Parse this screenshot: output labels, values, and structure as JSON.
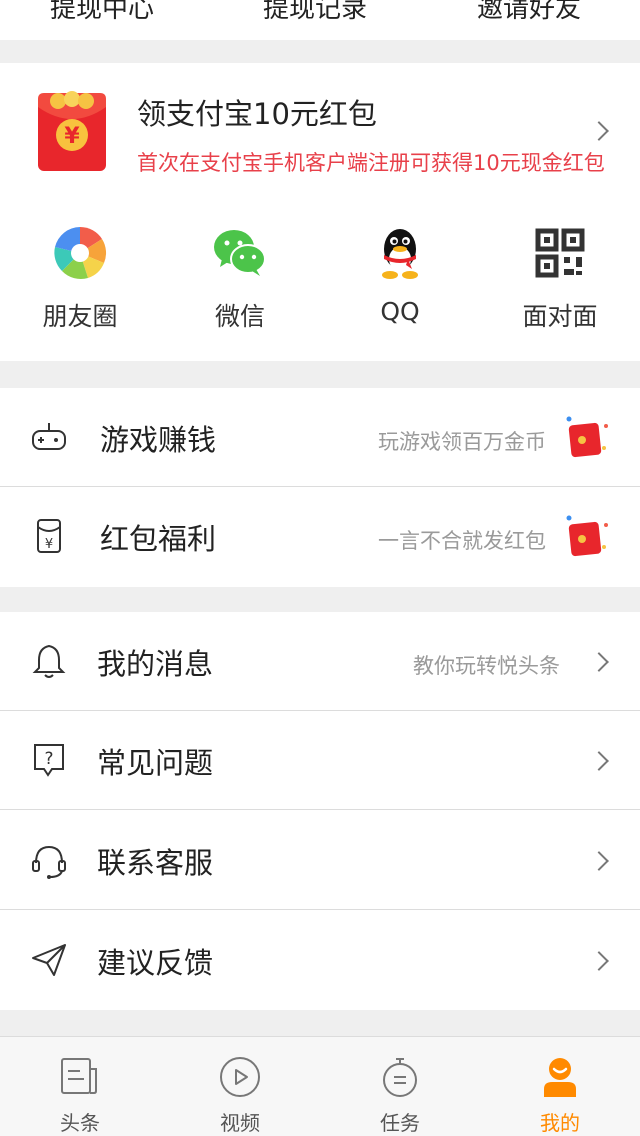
{
  "top_nav": {
    "items": [
      "提现中心",
      "提现记录",
      "邀请好友"
    ]
  },
  "alipay": {
    "title": "领支付宝10元红包",
    "subtitle": "首次在支付宝手机客户端注册可获得10元现金红包"
  },
  "share": {
    "items": [
      {
        "label": "朋友圈",
        "icon": "moments-icon"
      },
      {
        "label": "微信",
        "icon": "wechat-icon"
      },
      {
        "label": "QQ",
        "icon": "qq-icon"
      },
      {
        "label": "面对面",
        "icon": "qrcode-icon"
      }
    ]
  },
  "rewards": {
    "items": [
      {
        "label": "游戏赚钱",
        "hint": "玩游戏领百万金币",
        "icon": "gamepad-icon"
      },
      {
        "label": "红包福利",
        "hint": "一言不合就发红包",
        "icon": "red-envelope-icon"
      }
    ]
  },
  "menu": {
    "items": [
      {
        "label": "我的消息",
        "hint": "教你玩转悦头条",
        "icon": "bell-icon"
      },
      {
        "label": "常见问题",
        "hint": "",
        "icon": "question-icon"
      },
      {
        "label": "联系客服",
        "hint": "",
        "icon": "headset-icon"
      },
      {
        "label": "建议反馈",
        "hint": "",
        "icon": "paper-plane-icon"
      }
    ]
  },
  "tabbar": {
    "items": [
      {
        "label": "头条",
        "icon": "news-icon"
      },
      {
        "label": "视频",
        "icon": "play-icon"
      },
      {
        "label": "任务",
        "icon": "stopwatch-icon"
      },
      {
        "label": "我的",
        "icon": "profile-icon"
      }
    ],
    "active_index": 3
  },
  "colors": {
    "accent": "#ff8a00",
    "alert_red": "#e8404a",
    "background": "#efefef"
  }
}
